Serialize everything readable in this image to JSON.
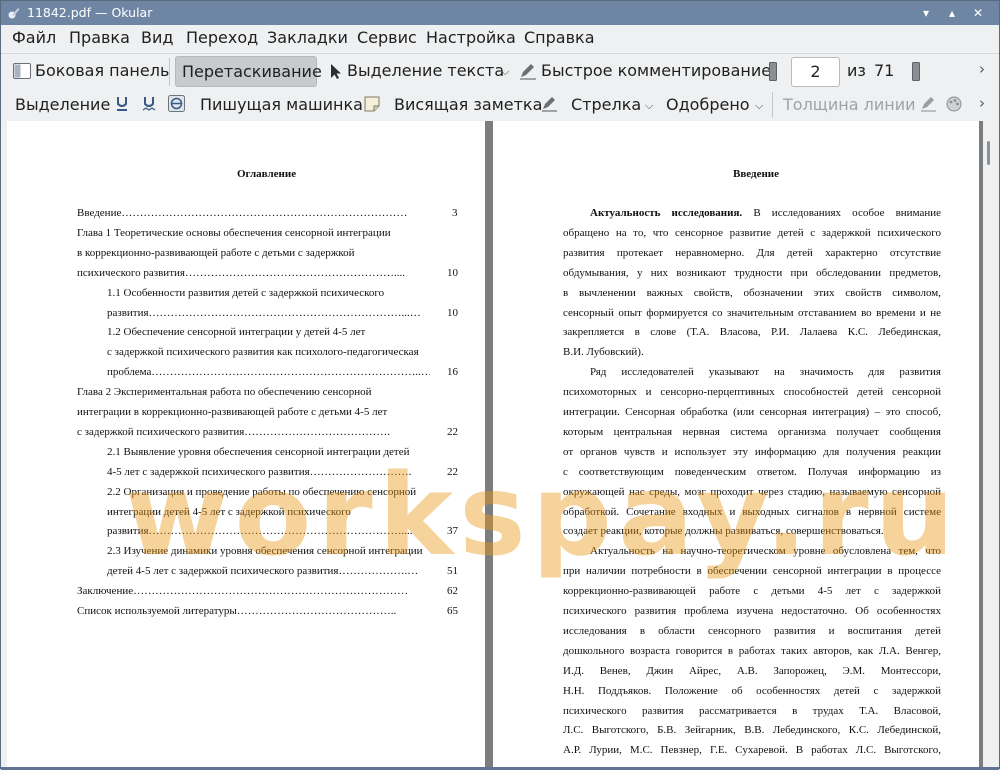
{
  "window": {
    "title": "11842.pdf  — Okular",
    "controls": [
      "▾",
      "▴",
      "✕"
    ]
  },
  "menu": [
    "Файл",
    "Правка",
    "Вид",
    "Переход",
    "Закладки",
    "Сервис",
    "Настройка",
    "Справка"
  ],
  "toolbar1": {
    "sidebar_label": "Боковая панель",
    "drag_label": "Перетаскивание",
    "text_select_label": "Выделение текста",
    "quick_comment_label": "Быстрое комментирование",
    "page_current": "2",
    "page_of_label": "из",
    "page_total": "71",
    "overflow": "›"
  },
  "toolbar2": {
    "select_label": "Выделение",
    "typewriter_label": "Пишущая машинка",
    "note_label": "Висящая заметка",
    "arrow_label": "Стрелка",
    "stamp_label": "Одобрено",
    "line_width_label": "Толщина линии",
    "overflow": "›"
  },
  "left_page": {
    "heading": "Оглавление",
    "toc": [
      {
        "text": "Введение……………………………………………………………………",
        "page": "3"
      },
      {
        "text": "Глава 1 Теоретические основы обеспечения сенсорной интеграции",
        "page": ""
      },
      {
        "text": "в коррекционно-развивающей работе с детьми с задержкой",
        "page": ""
      },
      {
        "text": "психического развития…………………………………………………....",
        "page": "10"
      },
      {
        "text": "1.1 Особенности развития детей с задержкой психического",
        "page": "",
        "indent": true
      },
      {
        "text": "развития……………………………………………………………...…",
        "page": "10",
        "indent": true
      },
      {
        "text": "1.2 Обеспечение сенсорной интеграции у детей 4-5 лет",
        "page": "",
        "indent": true
      },
      {
        "text": "с задержкой психического развития как психолого-педагогическая",
        "page": "",
        "indent": true
      },
      {
        "text": "проблема………………………………………………………………..…..",
        "page": "16",
        "indent": true
      },
      {
        "text": "Глава 2 Экспериментальная работа по обеспечению сенсорной",
        "page": ""
      },
      {
        "text": "интеграции в коррекционно-развивающей работе с детьми  4-5 лет",
        "page": ""
      },
      {
        "text": "с задержкой психического развития………………………………….",
        "page": "22"
      },
      {
        "text": "2.1 Выявление уровня обеспечения сенсорной интеграции детей",
        "page": "",
        "indent": true
      },
      {
        "text": "4-5 лет с задержкой психического развития……………………….",
        "page": "22",
        "indent": true
      },
      {
        "text": "2.2 Организация и проведение работы по обеспечению сенсорной",
        "page": "",
        "indent": true
      },
      {
        "text": "интеграции детей 4-5 лет с задержкой психического",
        "page": "",
        "indent": true
      },
      {
        "text": "развития……………………………………………………………....",
        "page": "37",
        "indent": true
      },
      {
        "text": "2.3 Изучение динамики уровня обеспечения сенсорной интеграции",
        "page": "",
        "indent": true
      },
      {
        "text": "детей 4-5 лет с задержкой психического развития……………….…",
        "page": "51",
        "indent": true
      },
      {
        "text": "Заключение…………………………………………………………………",
        "page": "62"
      },
      {
        "text": "Список используемой литературы……………………………………..",
        "page": "65"
      }
    ]
  },
  "right_page": {
    "heading": "Введение",
    "bold_lead": "Актуальность исследования.",
    "lines": [
      "В исследованиях особое внимание",
      "обращено на то, что сенсорное развитие детей с задержкой психического",
      "развития протекает неравномерно. Для детей характерно отсутствие",
      "обдумывания, у них возникают трудности при обследовании предметов,",
      "в вычленении важных свойств, обозначении этих свойств символом,",
      "сенсорный опыт формируется со значительным отставанием во времени и не",
      "закрепляется в слове (Т.А. Власова, Р.И. Лалаева К.С. Лебединская,",
      "В.И. Лубовский).",
      "Ряд исследователей указывают на значимость для развития",
      "психомоторных и сенсорно-перцептивных способностей детей сенсорной",
      "интеграции. Сенсорная обработка (или сенсорная интеграция) – это способ,",
      "которым центральная нервная система организма получает сообщения",
      "от органов чувств и использует эту информацию для получения реакции",
      "с соответствующим поведенческим ответом. Получая информацию из",
      "окружающей нас среды, мозг проходит через стадию, называемую сенсорной",
      "обработкой. Сочетание входных и выходных сигналов в нервной системе",
      "создает реакции, которые должны развиваться, совершенствоваться.",
      "Актуальность на научно-теоретическом уровне обусловлена тем, что",
      "при наличии потребности в обеспечении сенсорной интеграции в процессе",
      "коррекционно-развивающей работе с детьми 4-5 лет с задержкой",
      "психического развития проблема изучена недостаточно. Об особенностях",
      "исследования в области сенсорного развития и воспитания детей",
      "дошкольного возраста говорится в работах таких авторов, как Л.А. Венгер,",
      "И.Д. Венев, Джин Айрес, А.В. Запорожец, Э.М. Монтессори,",
      "Н.Н. Поддъяков. Положение об особенностях детей с задержкой",
      "психического развития рассматривается в трудах Т.А. Власовой,",
      "Л.С. Выготского, Б.В. Зейгарник, В.В. Лебединского, К.С. Лебединской,",
      "А.Р. Лурии, М.С. Певзнер, Г.Е. Сухаревой. В работах Л.С. Выготского,"
    ]
  },
  "watermark": "workspay.ru",
  "colors": {
    "titlebar": "#6e85a3",
    "toolbar_bg": "#eff0f1",
    "viewport_bg": "#7c7d7e",
    "watermark": "#eb9614"
  }
}
